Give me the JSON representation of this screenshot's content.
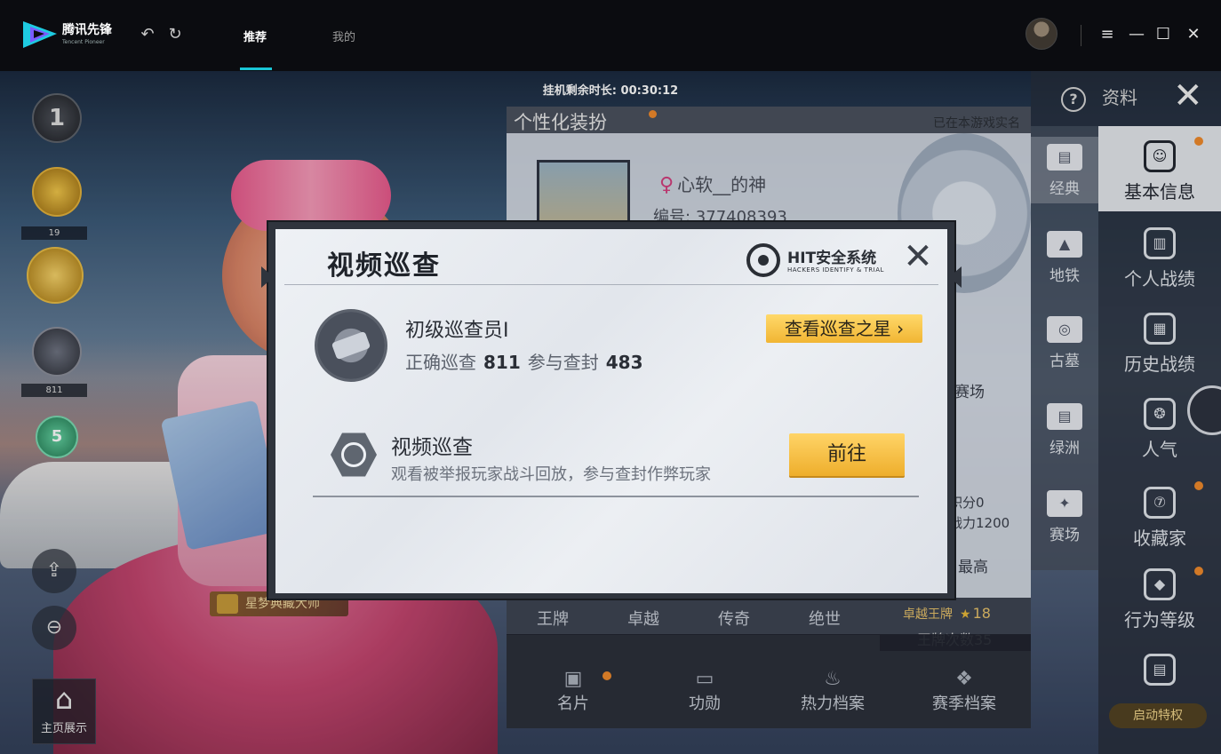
{
  "app": {
    "logo_name": "腾讯先锋",
    "logo_sub": "Tencent Pioneer",
    "back_icon": "undo-icon",
    "refresh_icon": "refresh-icon"
  },
  "nav": {
    "tabs": [
      {
        "label": "推荐",
        "active": true
      },
      {
        "label": "我的",
        "active": false
      }
    ],
    "accent": "#19c6d6"
  },
  "window_controls": {
    "menu_icon": "≡",
    "minimize_icon": "—",
    "maximize_icon": "☐",
    "close_icon": "✕"
  },
  "game": {
    "hang_time": "挂机剩余时长: 00:30:12",
    "left_rail": {
      "rank_1": "1",
      "rank_2_count": "19",
      "rank_4_count": "811",
      "rank_5": "5",
      "home_label": "主页展示"
    },
    "star_pill": "星梦典藏大师",
    "profile": {
      "title": "个性化装扮",
      "verified": "已在本游戏实名",
      "name": "心软__的神",
      "id": "编号: 377408393",
      "side_texts": {
        "arena": "赛场",
        "score": "积分0",
        "power": "战力1200",
        "highest": "最高"
      },
      "tiers": [
        "王牌",
        "卓越",
        "传奇",
        "绝世"
      ],
      "ace_title": "卓越王牌",
      "ace_stars": "18",
      "ace_count": "王牌次数35",
      "bottom_tabs": [
        "名片",
        "功勋",
        "热力档案",
        "赛季档案"
      ]
    },
    "sidebar_top": {
      "title": "资料",
      "help": "?"
    },
    "sidebar_narrow": [
      "经典",
      "地铁",
      "古墓",
      "绿洲",
      "赛场"
    ],
    "sidebar_wide": [
      "基本信息",
      "个人战绩",
      "历史战绩",
      "人气",
      "收藏家",
      "行为等级"
    ],
    "privilege": "启动特权"
  },
  "modal": {
    "title": "视频巡查",
    "brand": "HIT安全系统",
    "brand_sub": "HACKERS IDENTIFY & TRIAL",
    "rank": "初级巡查员I",
    "stats_label_1": "正确巡查",
    "stats_value_1": "811",
    "stats_label_2": "参与查封",
    "stats_value_2": "483",
    "star_button": "查看巡查之星 ›",
    "row_title": "视频巡查",
    "row_desc": "观看被举报玩家战斗回放，参与查封作弊玩家",
    "go_button": "前往"
  }
}
